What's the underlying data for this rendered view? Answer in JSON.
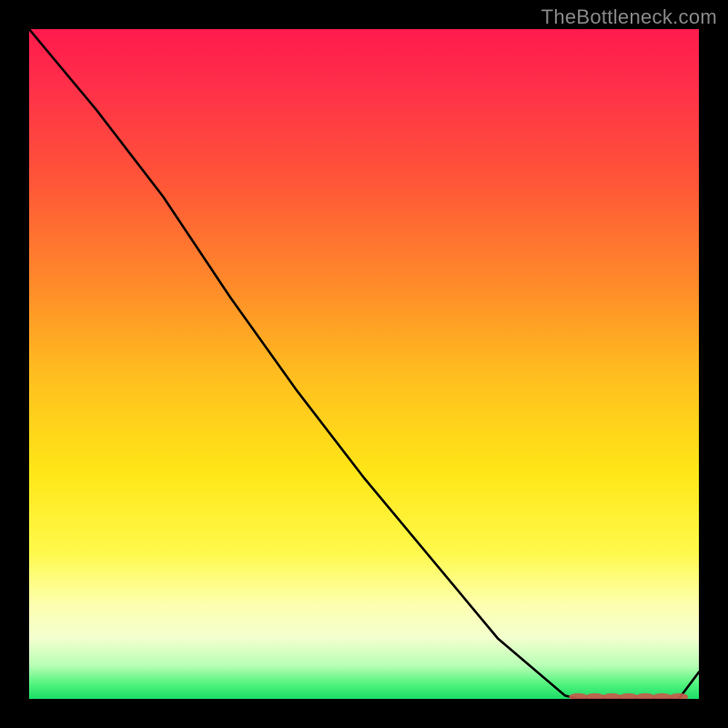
{
  "attribution": "TheBottleneck.com",
  "chart_data": {
    "type": "line",
    "title": "",
    "xlabel": "",
    "ylabel": "",
    "x": [
      0.0,
      0.1,
      0.2,
      0.3,
      0.4,
      0.5,
      0.6,
      0.7,
      0.8,
      0.82,
      0.9,
      0.97,
      1.0
    ],
    "values": [
      1.0,
      0.88,
      0.75,
      0.6,
      0.46,
      0.33,
      0.21,
      0.09,
      0.005,
      0.0,
      0.0,
      0.0,
      0.04
    ],
    "xlim": [
      0,
      1
    ],
    "ylim": [
      0,
      1
    ],
    "colors": {
      "top": "#ff1a4d",
      "mid": "#ffe617",
      "bottom": "#1bdc68",
      "line": "#000000",
      "marker": "#c85a4a"
    },
    "markers": {
      "y": 0.0,
      "x_start": 0.82,
      "x_end": 0.97,
      "count": 7
    }
  }
}
